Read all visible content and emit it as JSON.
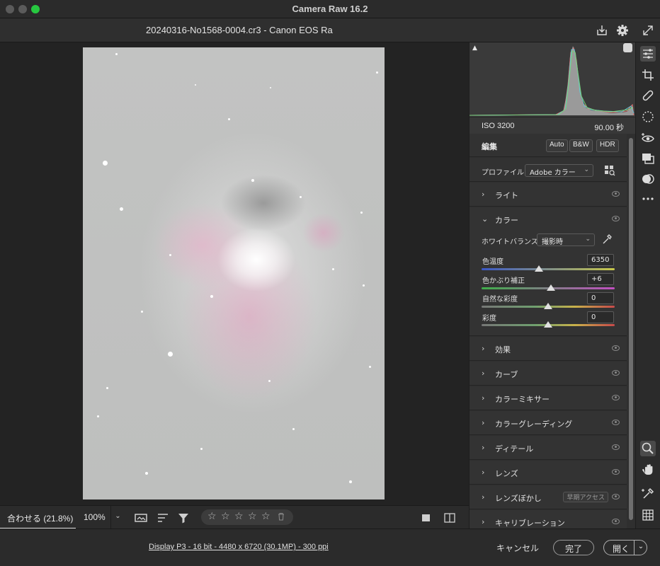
{
  "window": {
    "title": "Camera Raw 16.2"
  },
  "file": {
    "title": "20240316-No1568-0004.cr3  -  Canon EOS Ra"
  },
  "histogram": {
    "iso": "ISO 3200",
    "shutter": "90.00 秒"
  },
  "edit": {
    "title": "編集",
    "auto": "Auto",
    "bw": "B&W",
    "hdr": "HDR",
    "profile_label": "プロファイル",
    "profile_value": "Adobe カラー"
  },
  "sections": {
    "light": "ライト",
    "color": "カラー",
    "effects": "効果",
    "curve": "カーブ",
    "color_mixer": "カラーミキサー",
    "color_grading": "カラーグレーディング",
    "detail": "ディテール",
    "lens": "レンズ",
    "lens_blur": "レンズぼかし",
    "lens_blur_badge": "早期アクセス",
    "calibration": "キャリブレーション"
  },
  "color": {
    "wb_label": "ホワイトバランス",
    "wb_value": "撮影時",
    "sliders": [
      {
        "label": "色温度",
        "value": "6350",
        "position": 0.43
      },
      {
        "label": "色かぶり補正",
        "value": "+6",
        "position": 0.52
      },
      {
        "label": "自然な彩度",
        "value": "0",
        "position": 0.5
      },
      {
        "label": "彩度",
        "value": "0",
        "position": 0.5
      }
    ]
  },
  "bottom": {
    "zoom_fit": "合わせる (21.8%)",
    "zoom_100": "100%",
    "rating_stars": [
      "☆",
      "☆",
      "☆",
      "☆",
      "☆"
    ]
  },
  "status": {
    "info": "Display P3 - 16 bit - 4480 x 6720 (30.1MP) - 300 ppi",
    "cancel": "キャンセル",
    "done": "完了",
    "open": "開く"
  },
  "colors": {
    "accent_green": "#27c840",
    "panel_bg": "#2f2f2f",
    "photo_bg": "#c0c1c0"
  }
}
